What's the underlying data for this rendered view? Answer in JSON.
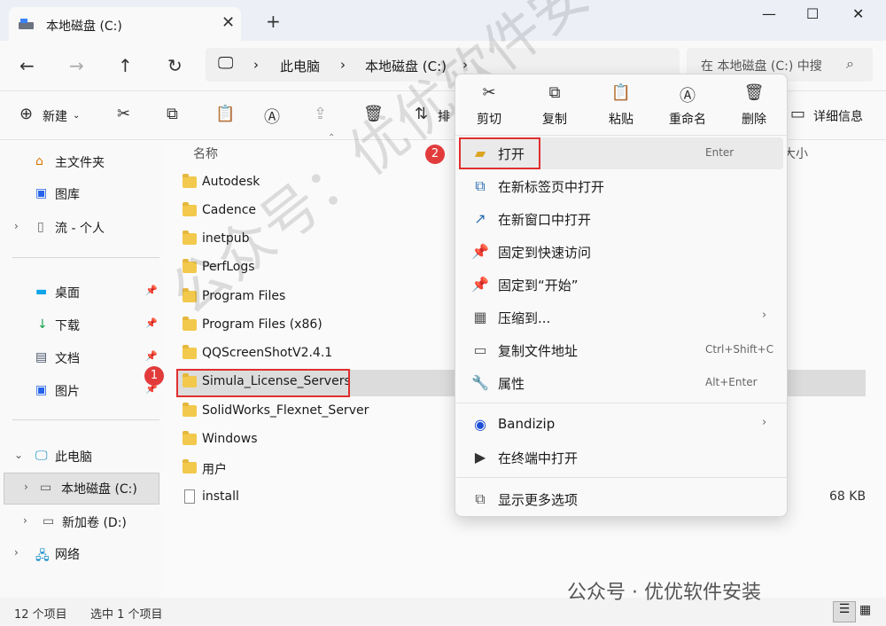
{
  "tab": {
    "title": "本地磁盘 (C:)",
    "close": "✕",
    "new_tab": "+"
  },
  "window_controls": {
    "minimize": "—",
    "maximize": "☐",
    "close": "✕"
  },
  "address": {
    "segments": [
      "此电脑",
      "本地磁盘 (C:)"
    ],
    "separator": "›",
    "search_placeholder": "在 本地磁盘 (C:) 中搜"
  },
  "commandbar": {
    "new_label": "新建",
    "sort_label": "排",
    "details_label": "详细信息"
  },
  "sidebar": {
    "items": [
      {
        "label": "主文件夹",
        "icon": "home-icon"
      },
      {
        "label": "图库",
        "icon": "gallery-icon"
      },
      {
        "label": "流 - 个人",
        "icon": "document-icon"
      },
      {
        "label": "桌面",
        "icon": "desktop-icon"
      },
      {
        "label": "下载",
        "icon": "download-icon"
      },
      {
        "label": "文档",
        "icon": "document-icon"
      },
      {
        "label": "图片",
        "icon": "pictures-icon"
      },
      {
        "label": "此电脑",
        "icon": "computer-icon"
      },
      {
        "label": "本地磁盘 (C:)",
        "icon": "drive-icon"
      },
      {
        "label": "新加卷 (D:)",
        "icon": "drive-icon"
      },
      {
        "label": "网络",
        "icon": "network-icon"
      }
    ]
  },
  "columns": {
    "name": "名称",
    "size": "大小"
  },
  "files": [
    {
      "name": "Autodesk",
      "type": "folder",
      "size": ""
    },
    {
      "name": "Cadence",
      "type": "folder",
      "size": ""
    },
    {
      "name": "inetpub",
      "type": "folder",
      "size": ""
    },
    {
      "name": "PerfLogs",
      "type": "folder",
      "size": ""
    },
    {
      "name": "Program Files",
      "type": "folder",
      "size": ""
    },
    {
      "name": "Program Files (x86)",
      "type": "folder",
      "size": ""
    },
    {
      "name": "QQScreenShotV2.4.1",
      "type": "folder",
      "size": ""
    },
    {
      "name": "Simula_License_Servers",
      "type": "folder",
      "size": ""
    },
    {
      "name": "SolidWorks_Flexnet_Server",
      "type": "folder",
      "size": ""
    },
    {
      "name": "Windows",
      "type": "folder",
      "size": ""
    },
    {
      "name": "用户",
      "type": "folder",
      "size": ""
    },
    {
      "name": "install",
      "type": "file",
      "size": "68 KB"
    }
  ],
  "context_menu": {
    "top_actions": [
      {
        "label": "剪切",
        "icon": "cut-icon"
      },
      {
        "label": "复制",
        "icon": "copy-icon"
      },
      {
        "label": "粘贴",
        "icon": "paste-icon"
      },
      {
        "label": "重命名",
        "icon": "rename-icon"
      },
      {
        "label": "删除",
        "icon": "delete-icon"
      }
    ],
    "items": [
      {
        "label": "打开",
        "shortcut": "Enter",
        "icon": "folder-open-icon"
      },
      {
        "label": "在新标签页中打开",
        "shortcut": "",
        "icon": "new-tab-icon"
      },
      {
        "label": "在新窗口中打开",
        "shortcut": "",
        "icon": "new-window-icon"
      },
      {
        "label": "固定到快速访问",
        "shortcut": "",
        "icon": "pin-icon"
      },
      {
        "label": "固定到“开始”",
        "shortcut": "",
        "icon": "pin-icon"
      },
      {
        "label": "压缩到...",
        "shortcut": "",
        "icon": "zip-icon"
      },
      {
        "label": "复制文件地址",
        "shortcut": "Ctrl+Shift+C",
        "icon": "copy-path-icon"
      },
      {
        "label": "属性",
        "shortcut": "Alt+Enter",
        "icon": "wrench-icon"
      },
      {
        "label": "Bandizip",
        "shortcut": "",
        "icon": "bandizip-icon"
      },
      {
        "label": "在终端中打开",
        "shortcut": "",
        "icon": "terminal-icon"
      },
      {
        "label": "显示更多选项",
        "shortcut": "",
        "icon": "more-options-icon"
      }
    ]
  },
  "annotations": {
    "badge1": "1",
    "badge2": "2"
  },
  "status": {
    "count": "12 个项目",
    "selected": "选中 1 个项目"
  },
  "watermark": {
    "diagonal": "公众号：优优软件安装",
    "bottom": "公众号 · 优优软件安装"
  }
}
